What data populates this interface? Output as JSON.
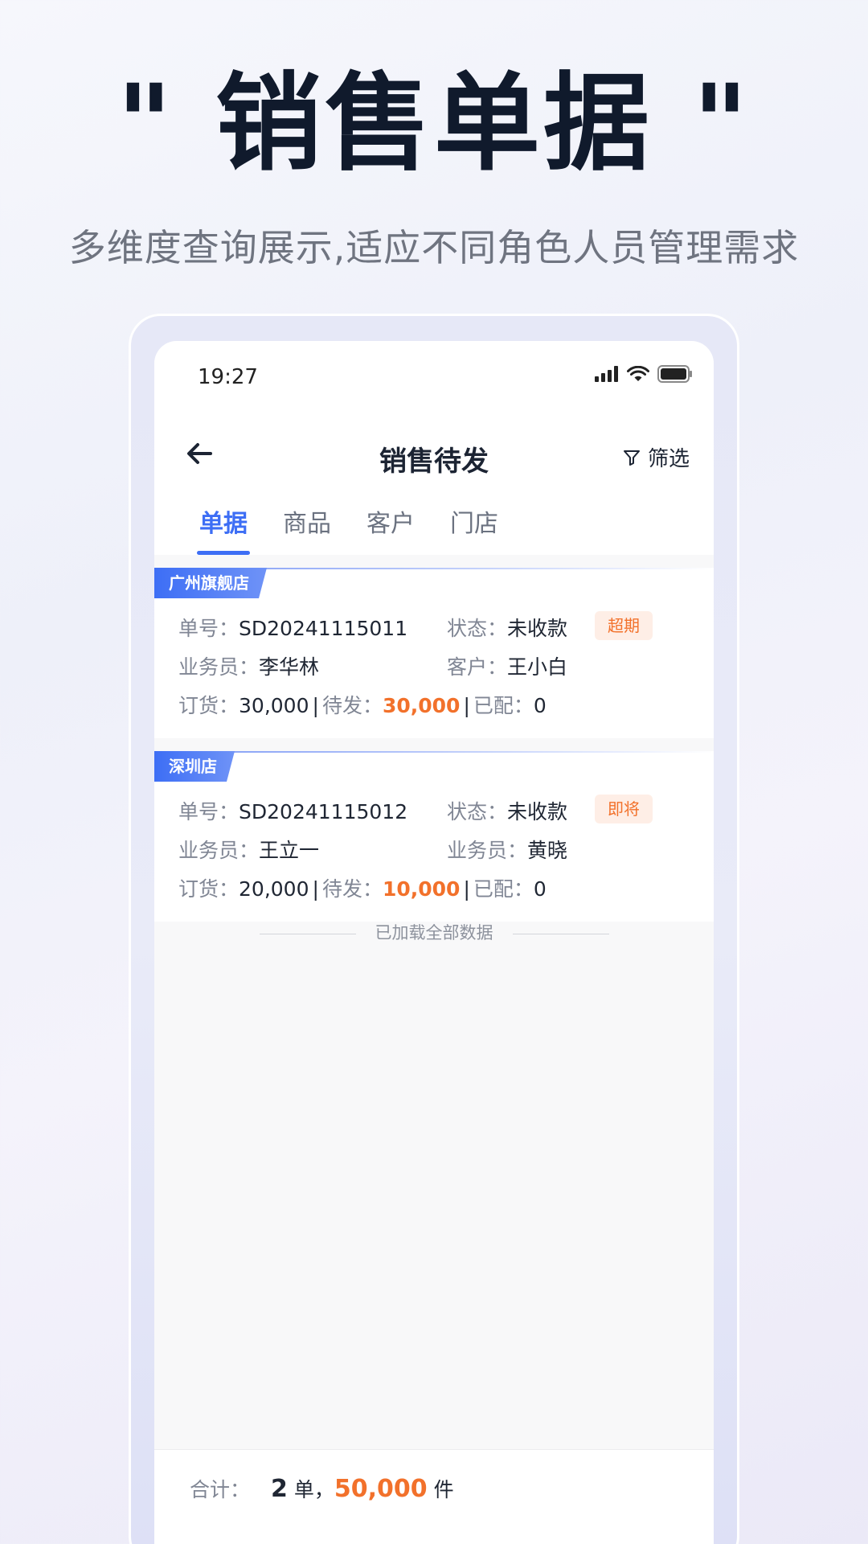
{
  "promo": {
    "headline": "\" 销售单据 \"",
    "subheadline": "多维度查询展示,适应不同角色人员管理需求"
  },
  "statusbar": {
    "time": "19:27",
    "icons": [
      "signal-icon",
      "wifi-icon",
      "battery-icon"
    ]
  },
  "navbar": {
    "title": "销售待发",
    "filter_label": "筛选"
  },
  "tabs": [
    {
      "label": "单据",
      "active": true
    },
    {
      "label": "商品",
      "active": false
    },
    {
      "label": "客户",
      "active": false
    },
    {
      "label": "门店",
      "active": false
    }
  ],
  "orders": [
    {
      "store": "广州旗舰店",
      "order_no_label": "单号：",
      "order_no": "SD20241115011",
      "status_label": "状态：",
      "status": "未收款",
      "badge": "超期",
      "sales_label": "业务员：",
      "sales": "李华林",
      "party_label": "客户：",
      "party": "王小白",
      "ordered_label": "订货：",
      "ordered": "30,000",
      "pending_label": "待发：",
      "pending": "30,000",
      "allocated_label": "已配：",
      "allocated": "0"
    },
    {
      "store": "深圳店",
      "order_no_label": "单号：",
      "order_no": "SD20241115012",
      "status_label": "状态：",
      "status": "未收款",
      "badge": "即将",
      "sales_label": "业务员：",
      "sales": "王立一",
      "party_label": "业务员：",
      "party": "黄晓",
      "ordered_label": "订货：",
      "ordered": "20,000",
      "pending_label": "待发：",
      "pending": "10,000",
      "allocated_label": "已配：",
      "allocated": "0"
    }
  ],
  "list_footer": "已加载全部数据",
  "summary": {
    "label": "合计：",
    "count": "2",
    "count_unit": "单，",
    "quantity": "50,000",
    "quantity_unit": "件"
  },
  "colors": {
    "accent": "#3d6ef5",
    "highlight": "#f2712b",
    "badge_bg": "#feeee6"
  }
}
